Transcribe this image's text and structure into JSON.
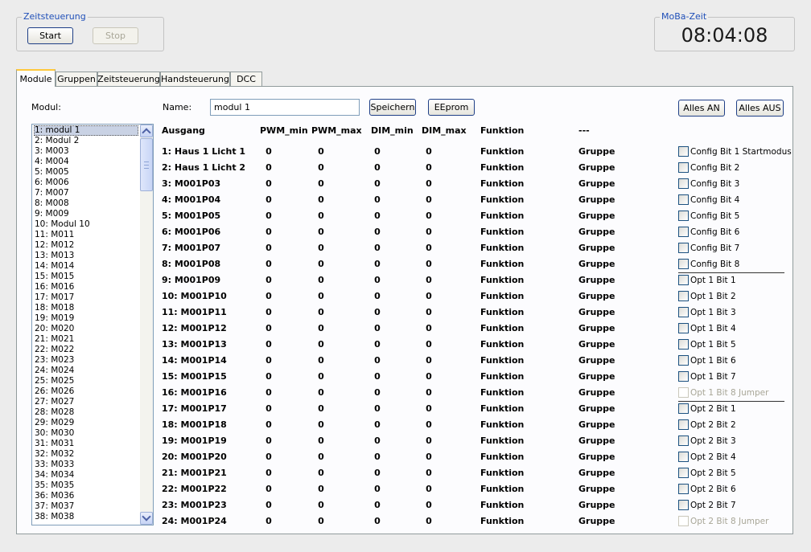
{
  "zeitsteuerung": {
    "legend": "Zeitsteuerung",
    "start_label": "Start",
    "stop_label": "Stop"
  },
  "moba": {
    "legend": "MoBa-Zeit",
    "time": "08:04:08"
  },
  "tabs": [
    "Module",
    "Gruppen",
    "Zeitsteuerung",
    "Handsteuerung",
    "DCC"
  ],
  "module_label": "Modul:",
  "name_label": "Name:",
  "name_value": "modul 1",
  "buttons": {
    "save": "Speichern",
    "eeprom": "EEprom",
    "all_on": "Alles AN",
    "all_off": "Alles AUS"
  },
  "modules": [
    "1: modul 1",
    "2: Modul 2",
    "3: M003",
    "4: M004",
    "5: M005",
    "6: M006",
    "7: M007",
    "8: M008",
    "9: M009",
    "10: Modul 10",
    "11: M011",
    "12: M012",
    "13: M013",
    "14: M014",
    "15: M015",
    "16: M016",
    "17: M017",
    "18: M018",
    "19: M019",
    "20: M020",
    "21: M021",
    "22: M022",
    "23: M023",
    "24: M024",
    "25: M025",
    "26: M026",
    "27: M027",
    "28: M028",
    "29: M029",
    "30: M030",
    "31: M031",
    "32: M032",
    "33: M033",
    "34: M034",
    "35: M035",
    "36: M036",
    "37: M037",
    "38: M038"
  ],
  "selected_module_index": 0,
  "headers": {
    "ausgang": "Ausgang",
    "pwm_min": "PWM_min",
    "pwm_max": "PWM_max",
    "dim_min": "DIM_min",
    "dim_max": "DIM_max",
    "funktion": "Funktion",
    "dash": "---"
  },
  "outputs": [
    {
      "name": "1: Haus 1 Licht 1",
      "pwm_min": "0",
      "pwm_max": "0",
      "dim_min": "0",
      "dim_max": "0",
      "funktion": "Funktion",
      "gruppe": "Gruppe"
    },
    {
      "name": "2: Haus 1 Licht 2",
      "pwm_min": "0",
      "pwm_max": "0",
      "dim_min": "0",
      "dim_max": "0",
      "funktion": "Funktion",
      "gruppe": "Gruppe"
    },
    {
      "name": "3: M001P03",
      "pwm_min": "0",
      "pwm_max": "0",
      "dim_min": "0",
      "dim_max": "0",
      "funktion": "Funktion",
      "gruppe": "Gruppe"
    },
    {
      "name": "4: M001P04",
      "pwm_min": "0",
      "pwm_max": "0",
      "dim_min": "0",
      "dim_max": "0",
      "funktion": "Funktion",
      "gruppe": "Gruppe"
    },
    {
      "name": "5: M001P05",
      "pwm_min": "0",
      "pwm_max": "0",
      "dim_min": "0",
      "dim_max": "0",
      "funktion": "Funktion",
      "gruppe": "Gruppe"
    },
    {
      "name": "6: M001P06",
      "pwm_min": "0",
      "pwm_max": "0",
      "dim_min": "0",
      "dim_max": "0",
      "funktion": "Funktion",
      "gruppe": "Gruppe"
    },
    {
      "name": "7: M001P07",
      "pwm_min": "0",
      "pwm_max": "0",
      "dim_min": "0",
      "dim_max": "0",
      "funktion": "Funktion",
      "gruppe": "Gruppe"
    },
    {
      "name": "8: M001P08",
      "pwm_min": "0",
      "pwm_max": "0",
      "dim_min": "0",
      "dim_max": "0",
      "funktion": "Funktion",
      "gruppe": "Gruppe"
    },
    {
      "name": "9: M001P09",
      "pwm_min": "0",
      "pwm_max": "0",
      "dim_min": "0",
      "dim_max": "0",
      "funktion": "Funktion",
      "gruppe": "Gruppe"
    },
    {
      "name": "10: M001P10",
      "pwm_min": "0",
      "pwm_max": "0",
      "dim_min": "0",
      "dim_max": "0",
      "funktion": "Funktion",
      "gruppe": "Gruppe"
    },
    {
      "name": "11: M001P11",
      "pwm_min": "0",
      "pwm_max": "0",
      "dim_min": "0",
      "dim_max": "0",
      "funktion": "Funktion",
      "gruppe": "Gruppe"
    },
    {
      "name": "12: M001P12",
      "pwm_min": "0",
      "pwm_max": "0",
      "dim_min": "0",
      "dim_max": "0",
      "funktion": "Funktion",
      "gruppe": "Gruppe"
    },
    {
      "name": "13: M001P13",
      "pwm_min": "0",
      "pwm_max": "0",
      "dim_min": "0",
      "dim_max": "0",
      "funktion": "Funktion",
      "gruppe": "Gruppe"
    },
    {
      "name": "14: M001P14",
      "pwm_min": "0",
      "pwm_max": "0",
      "dim_min": "0",
      "dim_max": "0",
      "funktion": "Funktion",
      "gruppe": "Gruppe"
    },
    {
      "name": "15: M001P15",
      "pwm_min": "0",
      "pwm_max": "0",
      "dim_min": "0",
      "dim_max": "0",
      "funktion": "Funktion",
      "gruppe": "Gruppe"
    },
    {
      "name": "16: M001P16",
      "pwm_min": "0",
      "pwm_max": "0",
      "dim_min": "0",
      "dim_max": "0",
      "funktion": "Funktion",
      "gruppe": "Gruppe"
    },
    {
      "name": "17: M001P17",
      "pwm_min": "0",
      "pwm_max": "0",
      "dim_min": "0",
      "dim_max": "0",
      "funktion": "Funktion",
      "gruppe": "Gruppe"
    },
    {
      "name": "18: M001P18",
      "pwm_min": "0",
      "pwm_max": "0",
      "dim_min": "0",
      "dim_max": "0",
      "funktion": "Funktion",
      "gruppe": "Gruppe"
    },
    {
      "name": "19: M001P19",
      "pwm_min": "0",
      "pwm_max": "0",
      "dim_min": "0",
      "dim_max": "0",
      "funktion": "Funktion",
      "gruppe": "Gruppe"
    },
    {
      "name": "20: M001P20",
      "pwm_min": "0",
      "pwm_max": "0",
      "dim_min": "0",
      "dim_max": "0",
      "funktion": "Funktion",
      "gruppe": "Gruppe"
    },
    {
      "name": "21: M001P21",
      "pwm_min": "0",
      "pwm_max": "0",
      "dim_min": "0",
      "dim_max": "0",
      "funktion": "Funktion",
      "gruppe": "Gruppe"
    },
    {
      "name": "22: M001P22",
      "pwm_min": "0",
      "pwm_max": "0",
      "dim_min": "0",
      "dim_max": "0",
      "funktion": "Funktion",
      "gruppe": "Gruppe"
    },
    {
      "name": "23: M001P23",
      "pwm_min": "0",
      "pwm_max": "0",
      "dim_min": "0",
      "dim_max": "0",
      "funktion": "Funktion",
      "gruppe": "Gruppe"
    },
    {
      "name": "24: M001P24",
      "pwm_min": "0",
      "pwm_max": "0",
      "dim_min": "0",
      "dim_max": "0",
      "funktion": "Funktion",
      "gruppe": "Gruppe"
    }
  ],
  "config_bits": [
    {
      "label": "Config Bit 1 Startmodus",
      "checked": false,
      "disabled": false
    },
    {
      "label": "Config Bit 2",
      "checked": false,
      "disabled": false
    },
    {
      "label": "Config Bit 3",
      "checked": false,
      "disabled": false
    },
    {
      "label": "Config Bit 4",
      "checked": false,
      "disabled": false
    },
    {
      "label": "Config Bit 5",
      "checked": false,
      "disabled": false
    },
    {
      "label": "Config Bit 6",
      "checked": false,
      "disabled": false
    },
    {
      "label": "Config Bit 7",
      "checked": false,
      "disabled": false
    },
    {
      "label": "Config Bit 8",
      "checked": false,
      "disabled": false
    },
    {
      "label": "Opt 1 Bit 1",
      "checked": false,
      "disabled": false
    },
    {
      "label": "Opt 1 Bit 2",
      "checked": false,
      "disabled": false
    },
    {
      "label": "Opt 1 Bit 3",
      "checked": false,
      "disabled": false
    },
    {
      "label": "Opt 1 Bit 4",
      "checked": false,
      "disabled": false
    },
    {
      "label": "Opt 1 Bit 5",
      "checked": false,
      "disabled": false
    },
    {
      "label": "Opt 1 Bit 6",
      "checked": false,
      "disabled": false
    },
    {
      "label": "Opt 1 Bit 7",
      "checked": false,
      "disabled": false
    },
    {
      "label": "Opt 1 Bit 8 Jumper",
      "checked": false,
      "disabled": true
    },
    {
      "label": "Opt 2 Bit 1",
      "checked": false,
      "disabled": false
    },
    {
      "label": "Opt 2 Bit 2",
      "checked": false,
      "disabled": false
    },
    {
      "label": "Opt 2 Bit 3",
      "checked": false,
      "disabled": false
    },
    {
      "label": "Opt 2 Bit 4",
      "checked": false,
      "disabled": false
    },
    {
      "label": "Opt 2 Bit 5",
      "checked": false,
      "disabled": false
    },
    {
      "label": "Opt 2 Bit 6",
      "checked": false,
      "disabled": false
    },
    {
      "label": "Opt 2 Bit 7",
      "checked": false,
      "disabled": false
    },
    {
      "label": "Opt 2 Bit 8 Jumper",
      "checked": false,
      "disabled": true
    }
  ],
  "colors": {
    "legend": "#1f4fb8",
    "tab_accent": "#ffc83c",
    "selection": "#c9d2e4",
    "disabled_text": "#a8a697"
  }
}
